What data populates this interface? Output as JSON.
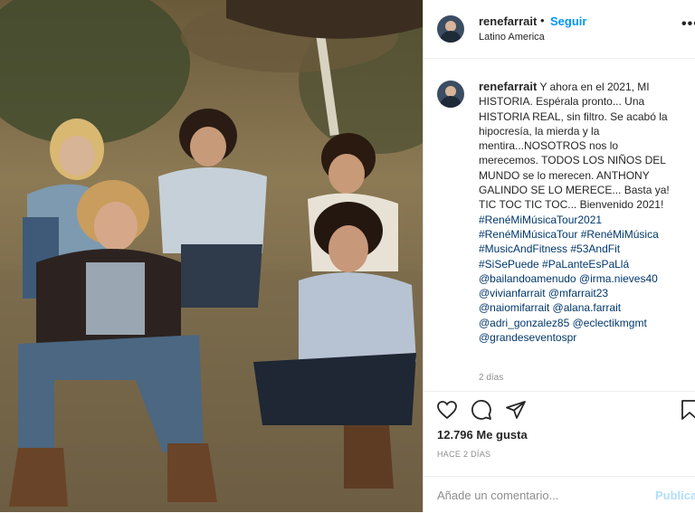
{
  "post": {
    "username": "renefarrait",
    "dot": "•",
    "follow_label": "Seguir",
    "location": "Latino America",
    "more_label": "•••"
  },
  "caption": {
    "username": "renefarrait",
    "lines": [
      {
        "text": "Y ahora en el 2021, MI",
        "tag": false
      },
      {
        "text": "HISTORIA. Espérala pronto... Una",
        "tag": false
      },
      {
        "text": "HISTORIA REAL, sin filtro. Se acabó la",
        "tag": false
      },
      {
        "text": "hipocresía, la mierda y la",
        "tag": false
      },
      {
        "text": "mentira...NOSOTROS nos lo",
        "tag": false
      },
      {
        "text": "merecemos. TODOS LOS NIÑOS DEL",
        "tag": false
      },
      {
        "text": "MUNDO se lo merecen. ANTHONY",
        "tag": false
      },
      {
        "text": "GALINDO SE LO MERECE... Basta ya!",
        "tag": false
      },
      {
        "text": "TIC TOC TIC TOC... Bienvenido 2021!",
        "tag": false
      },
      {
        "text": "#RenéMiMúsicaTour2021",
        "tag": true
      },
      {
        "text": "#RenéMiMúsicaTour #RenéMiMúsica",
        "tag": true
      },
      {
        "text": "#MusicAndFitness #53AndFit",
        "tag": true
      },
      {
        "text": "#SiSePuede #PaLanteEsPaLlá",
        "tag": true
      },
      {
        "text": "@bailandoamenudo @irma.nieves40",
        "tag": true
      },
      {
        "text": "@vivianfarrait @mfarrait23",
        "tag": true
      },
      {
        "text": "@naiomifarrait @alana.farrait",
        "tag": true
      },
      {
        "text": "@adri_gonzalez85 @eclectikmgmt",
        "tag": true
      },
      {
        "text": "@grandeseventospr",
        "tag": true
      }
    ],
    "age": "2 días"
  },
  "actions": {
    "like": "heart-icon",
    "comment": "comment-icon",
    "share": "share-icon",
    "save": "bookmark-icon"
  },
  "likes_label": "12.796 Me gusta",
  "time_ago": "HACE 2 DÍAS",
  "comment_box": {
    "placeholder": "Añade un comentario...",
    "publish_label": "Publicar"
  },
  "colors": {
    "link_blue": "#0095f6",
    "tag_blue": "#00376b",
    "muted": "#8e8e8e"
  }
}
